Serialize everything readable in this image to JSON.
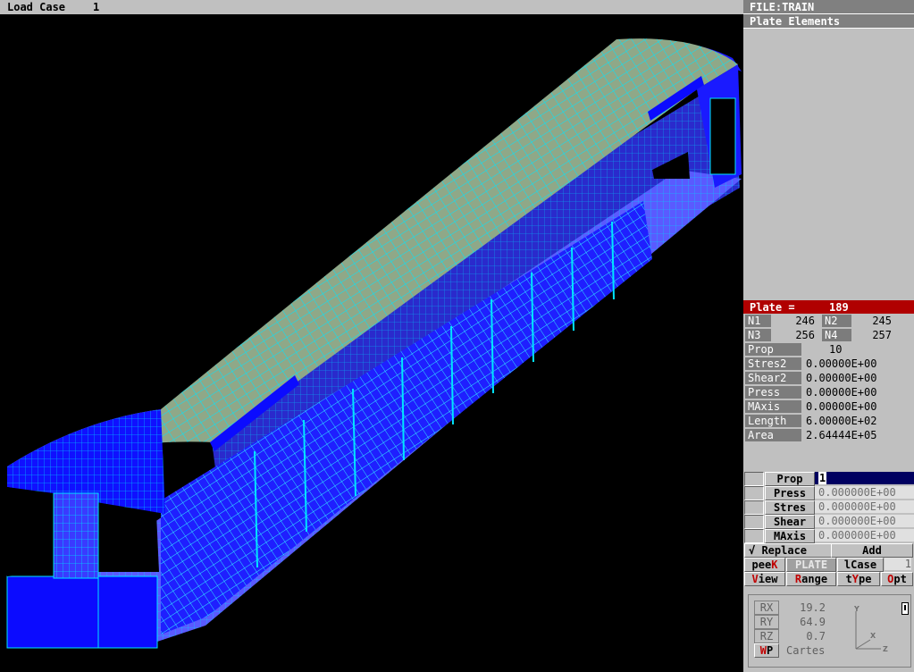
{
  "titlebar": {
    "load_case_label": "Load Case",
    "load_case_value": "1"
  },
  "panel": {
    "file": "FILE:TRAIN",
    "mode": "Plate Elements",
    "plate": {
      "label": "Plate =",
      "value": "189"
    },
    "nodes": [
      {
        "label": "N1",
        "value": "246"
      },
      {
        "label": "N2",
        "value": "245"
      },
      {
        "label": "N3",
        "value": "256"
      },
      {
        "label": "N4",
        "value": "257"
      }
    ],
    "props": [
      {
        "label": "Prop",
        "value": "10"
      },
      {
        "label": "Stres2",
        "value": "0.00000E+00"
      },
      {
        "label": "Shear2",
        "value": "0.00000E+00"
      },
      {
        "label": "Press",
        "value": "0.00000E+00"
      },
      {
        "label": "MAxis",
        "value": "0.00000E+00"
      },
      {
        "label": "Length",
        "value": "6.00000E+02"
      },
      {
        "label": "Area",
        "value": "2.64444E+05"
      }
    ],
    "edit": [
      {
        "label": "Prop",
        "value": "1"
      },
      {
        "label": "Press",
        "value": "0.000000E+00"
      },
      {
        "label": "Stres",
        "value": "0.000000E+00"
      },
      {
        "label": "Shear",
        "value": "0.000000E+00"
      },
      {
        "label": "MAxis",
        "value": "0.000000E+00"
      }
    ],
    "replace_label": "√ Replace",
    "add_label": "Add",
    "menu1": {
      "peek_a": "pee",
      "peek_b": "K",
      "plate": "PLATE",
      "lcase_a": "l",
      "lcase_b": "Case",
      "lcase_value": "1"
    },
    "menu2": {
      "view_a": "V",
      "view_b": "iew",
      "range_a": "R",
      "range_b": "ange",
      "type_a": "t",
      "type_b": "Y",
      "type_c": "pe",
      "opt_a": "O",
      "opt_b": "pt"
    },
    "rotation": {
      "rx_label": "RX",
      "rx": "19.2",
      "ry_label": "RY",
      "ry": "64.9",
      "rz_label": "RZ",
      "rz": "0.7",
      "wp_a": "W",
      "wp_b": "P",
      "coord": "Cartes",
      "axis_y": "Y",
      "axis_x": "X",
      "axis_z": "Z"
    }
  },
  "colors": {
    "mesh": "#00e5ff",
    "shell": "#1a1aff",
    "roof": "#8fa888",
    "background": "#000000",
    "highlight": "#b00000"
  }
}
